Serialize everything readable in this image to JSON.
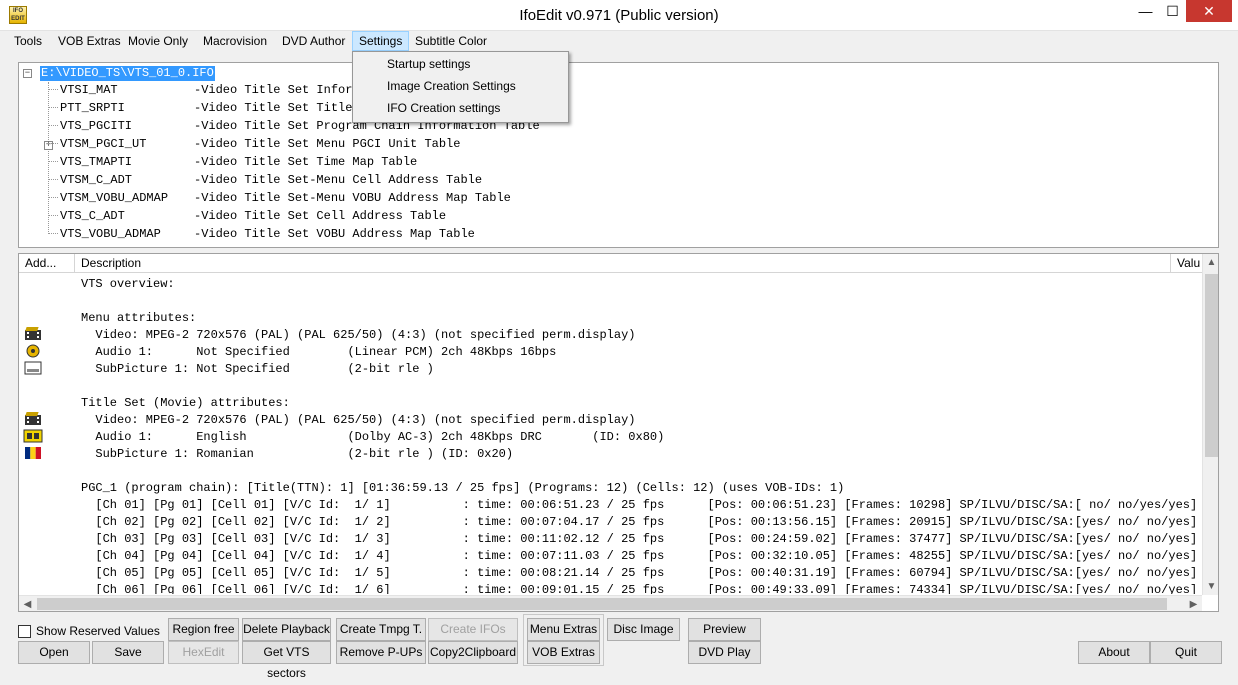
{
  "window": {
    "title": "IfoEdit v0.971 (Public version)",
    "icon_text": "IFO EDIT",
    "min": "—",
    "max": "☐",
    "close": "✕"
  },
  "menubar": {
    "items": [
      "Tools",
      "VOB Extras",
      "Movie Only",
      "Macrovision",
      "DVD Author",
      "Settings",
      "Subtitle Color"
    ],
    "active": "Settings"
  },
  "dropdown": {
    "items": [
      "Startup settings",
      "Image Creation Settings",
      "IFO Creation settings"
    ]
  },
  "tree": {
    "root": "E:\\VIDEO_TS\\VTS_01_0.IFO",
    "rows": [
      {
        "code": "VTSI_MAT",
        "desc": "-Video Title Set Information Management Table"
      },
      {
        "code": "PTT_SRPTI",
        "desc": "-Video Title Set Title"
      },
      {
        "code": "VTS_PGCITI",
        "desc": "-Video Title Set Program Chain Information Table"
      },
      {
        "code": "VTSM_PGCI_UT",
        "desc": "-Video Title Set Menu PGCI Unit Table"
      },
      {
        "code": "VTS_TMAPTI",
        "desc": "-Video Title Set Time Map Table"
      },
      {
        "code": "VTSM_C_ADT",
        "desc": "-Video Title Set-Menu Cell Address Table"
      },
      {
        "code": "VTSM_VOBU_ADMAP",
        "desc": "-Video Title Set-Menu VOBU Address Map Table"
      },
      {
        "code": "VTS_C_ADT",
        "desc": "-Video Title Set Cell Address Table"
      },
      {
        "code": "VTS_VOBU_ADMAP",
        "desc": "-Video Title Set VOBU Address Map Table"
      }
    ]
  },
  "list": {
    "columns": [
      "Add...",
      "Description",
      "Valu"
    ],
    "lines": [
      "VTS overview:",
      "",
      "Menu attributes:",
      "  Video: MPEG-2 720x576 (PAL) (PAL 625/50) (4:3) (not specified perm.display)",
      "  Audio 1:      Not Specified        (Linear PCM) 2ch 48Kbps 16bps",
      "  SubPicture 1: Not Specified        (2-bit rle )",
      "",
      "Title Set (Movie) attributes:",
      "  Video: MPEG-2 720x576 (PAL) (PAL 625/50) (4:3) (not specified perm.display)",
      "  Audio 1:      English              (Dolby AC-3) 2ch 48Kbps DRC       (ID: 0x80)",
      "  SubPicture 1: Romanian             (2-bit rle ) (ID: 0x20)",
      "",
      "PGC_1 (program chain): [Title(TTN): 1] [01:36:59.13 / 25 fps] (Programs: 12) (Cells: 12) (uses VOB-IDs: 1)",
      "  [Ch 01] [Pg 01] [Cell 01] [V/C Id:  1/ 1]          : time: 00:06:51.23 / 25 fps      [Pos: 00:06:51.23] [Frames: 10298] SP/ILVU/DISC/SA:[ no/ no/yes/yes]",
      "  [Ch 02] [Pg 02] [Cell 02] [V/C Id:  1/ 2]          : time: 00:07:04.17 / 25 fps      [Pos: 00:13:56.15] [Frames: 20915] SP/ILVU/DISC/SA:[yes/ no/ no/yes]",
      "  [Ch 03] [Pg 03] [Cell 03] [V/C Id:  1/ 3]          : time: 00:11:02.12 / 25 fps      [Pos: 00:24:59.02] [Frames: 37477] SP/ILVU/DISC/SA:[yes/ no/ no/yes]",
      "  [Ch 04] [Pg 04] [Cell 04] [V/C Id:  1/ 4]          : time: 00:07:11.03 / 25 fps      [Pos: 00:32:10.05] [Frames: 48255] SP/ILVU/DISC/SA:[yes/ no/ no/yes]",
      "  [Ch 05] [Pg 05] [Cell 05] [V/C Id:  1/ 5]          : time: 00:08:21.14 / 25 fps      [Pos: 00:40:31.19] [Frames: 60794] SP/ILVU/DISC/SA:[yes/ no/ no/yes]",
      "  [Ch 06] [Pg 06] [Cell 06] [V/C Id:  1/ 6]          : time: 00:09:01.15 / 25 fps      [Pos: 00:49:33.09] [Frames: 74334] SP/ILVU/DISC/SA:[yes/ no/ no/yes]"
    ]
  },
  "scroll": {
    "up": "▲",
    "down": "▼",
    "left": "◀",
    "right": "▶"
  },
  "controls": {
    "show_reserved": "Show Reserved Values",
    "buttons": {
      "region_free": "Region free",
      "delete_playback": "Delete Playback",
      "create_tmpg": "Create Tmpg T.",
      "create_ifos": "Create IFOs",
      "menu_extras": "Menu Extras",
      "disc_image": "Disc Image",
      "preview": "Preview",
      "open": "Open",
      "save": "Save",
      "hexedit": "HexEdit",
      "get_vts_sectors": "Get VTS sectors",
      "remove_pups": "Remove P-UPs",
      "copy2clipboard": "Copy2Clipboard",
      "vob_extras": "VOB Extras",
      "dvd_play": "DVD Play",
      "about": "About",
      "quit": "Quit"
    }
  },
  "colors": {
    "selection": "#3399ff",
    "close_button": "#c7372f",
    "menu_highlight": "#cce8ff"
  }
}
